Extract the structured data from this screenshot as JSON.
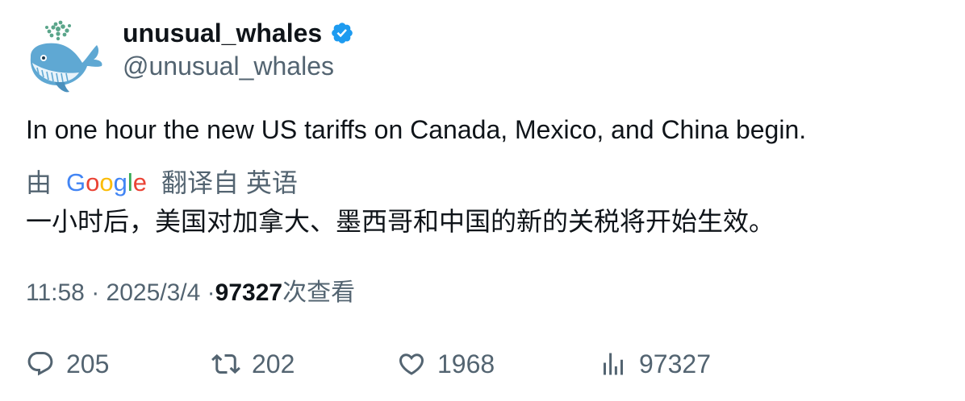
{
  "user": {
    "display_name": "unusual_whales",
    "handle": "@unusual_whales",
    "verified_color": "#1d9bf0"
  },
  "tweet": {
    "text": "In one hour the new US tariffs on Canada, Mexico, and China begin."
  },
  "translation": {
    "prefix": "由",
    "provider": "Google",
    "suffix": "翻译自 英语",
    "text": "一小时后，美国对加拿大、墨西哥和中国的新的关税将开始生效。"
  },
  "meta": {
    "time": "11:58",
    "separator": "·",
    "date": "2025/3/4",
    "views_count": "97327",
    "views_label": "次查看"
  },
  "actions": {
    "reply_count": "205",
    "retweet_count": "202",
    "like_count": "1968",
    "views_count": "97327"
  },
  "icons": {
    "reply": "reply-icon",
    "retweet": "retweet-icon",
    "like": "heart-icon",
    "views": "analytics-icon",
    "verified": "verified-badge-icon"
  }
}
